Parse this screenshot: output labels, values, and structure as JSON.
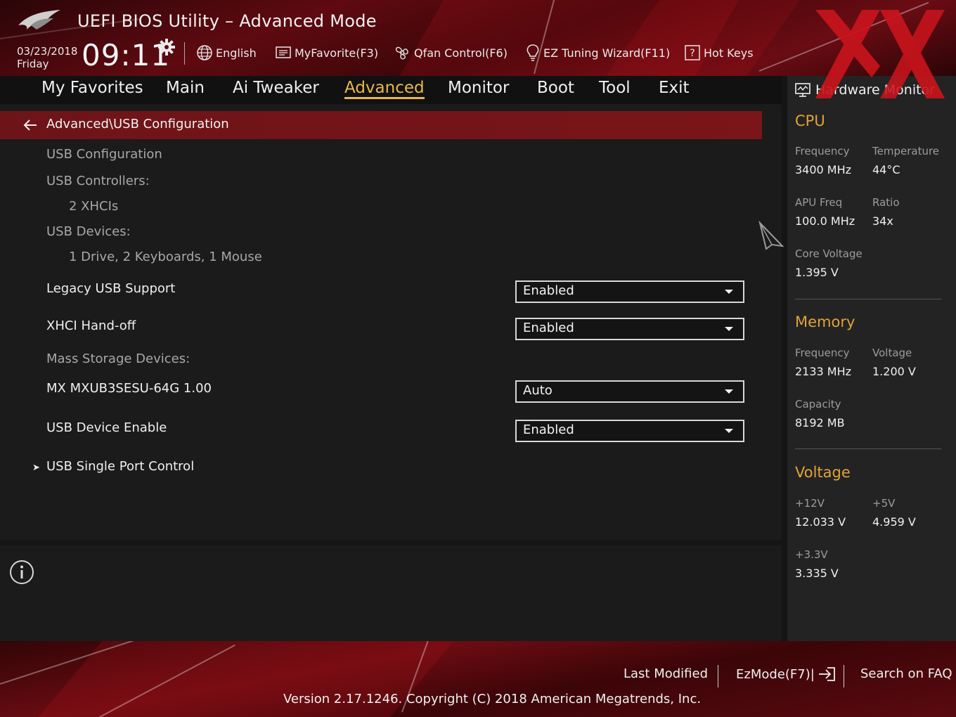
{
  "header": {
    "title": "UEFI BIOS Utility – Advanced Mode",
    "date": "03/23/2018",
    "weekday": "Friday",
    "time": "09:11",
    "items": {
      "language": "English",
      "my_favorite": "MyFavorite(F3)",
      "qfan": "Qfan Control(F6)",
      "ez_tuning": "EZ Tuning Wizard(F11)",
      "hot_keys": "Hot Keys"
    }
  },
  "nav": {
    "tabs": [
      "My Favorites",
      "Main",
      "Ai Tweaker",
      "Advanced",
      "Monitor",
      "Boot",
      "Tool",
      "Exit"
    ],
    "active": "Advanced"
  },
  "main": {
    "breadcrumb": "Advanced\\USB Configuration",
    "usb_configuration": "USB Configuration",
    "usb_controllers_label": "USB Controllers:",
    "usb_controllers_value": "2 XHCIs",
    "usb_devices_label": "USB Devices:",
    "usb_devices_value": "1 Drive, 2 Keyboards, 1 Mouse",
    "legacy_usb_support": {
      "label": "Legacy USB Support",
      "value": "Enabled"
    },
    "xhci_handoff": {
      "label": "XHCI Hand-off",
      "value": "Enabled"
    },
    "mass_storage_label": "Mass Storage Devices:",
    "mass_storage_device": {
      "label": "MX MXUB3SESU-64G 1.00",
      "value": "Auto"
    },
    "usb_device_enable": {
      "label": "USB Device Enable",
      "value": "Enabled"
    },
    "usb_single_port_control": "USB Single Port Control"
  },
  "hwmon": {
    "title": "Hardware Monitor",
    "cpu": {
      "heading": "CPU",
      "frequency_label": "Frequency",
      "frequency": "3400 MHz",
      "temperature_label": "Temperature",
      "temperature": "44°C",
      "apu_freq_label": "APU Freq",
      "apu_freq": "100.0 MHz",
      "ratio_label": "Ratio",
      "ratio": "34x",
      "core_voltage_label": "Core Voltage",
      "core_voltage": "1.395 V"
    },
    "memory": {
      "heading": "Memory",
      "frequency_label": "Frequency",
      "frequency": "2133 MHz",
      "voltage_label": "Voltage",
      "voltage": "1.200 V",
      "capacity_label": "Capacity",
      "capacity": "8192 MB"
    },
    "voltage": {
      "heading": "Voltage",
      "v12_label": "+12V",
      "v12": "12.033 V",
      "v5_label": "+5V",
      "v5": "4.959 V",
      "v33_label": "+3.3V",
      "v33": "3.335 V"
    }
  },
  "footer": {
    "last_modified": "Last Modified",
    "ezmode": "EzMode(F7)|",
    "search_faq": "Search on FAQ",
    "version": "Version 2.17.1246. Copyright (C) 2018 American Megatrends, Inc."
  },
  "colors": {
    "accent": "#e9b84b",
    "section_heading": "#e2a23a",
    "breadcrumb_bar": "#7a1519",
    "header_red": "#5e0a10"
  },
  "icons": [
    "rog-logo",
    "gear-icon",
    "globe-icon",
    "favorites-icon",
    "fan-icon",
    "lightbulb-icon",
    "help-icon",
    "back-arrow-icon",
    "submenu-arrow-icon",
    "info-icon",
    "monitor-icon",
    "ezmode-exit-icon",
    "xx-watermark-logo",
    "mouse-cursor-icon"
  ]
}
